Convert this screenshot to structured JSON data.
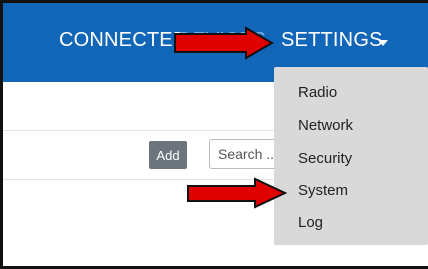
{
  "navbar": {
    "connected_label": "CONNECTED",
    "hidden_label": "DEVICES",
    "settings_label": "SETTINGS"
  },
  "toolbar": {
    "add_label": "Add",
    "search_placeholder": "Search ..."
  },
  "settings_menu": {
    "items": [
      {
        "label": "Radio"
      },
      {
        "label": "Network"
      },
      {
        "label": "Security"
      },
      {
        "label": "System"
      },
      {
        "label": "Log"
      }
    ]
  },
  "colors": {
    "navbar": "#1266b8",
    "dropdown": "#d9d9d9",
    "arrow_fill": "#e00000",
    "arrow_stroke": "#111111"
  },
  "icons": {
    "caret": "caret-down-icon",
    "annotation_arrow": "red-arrow-icon"
  }
}
